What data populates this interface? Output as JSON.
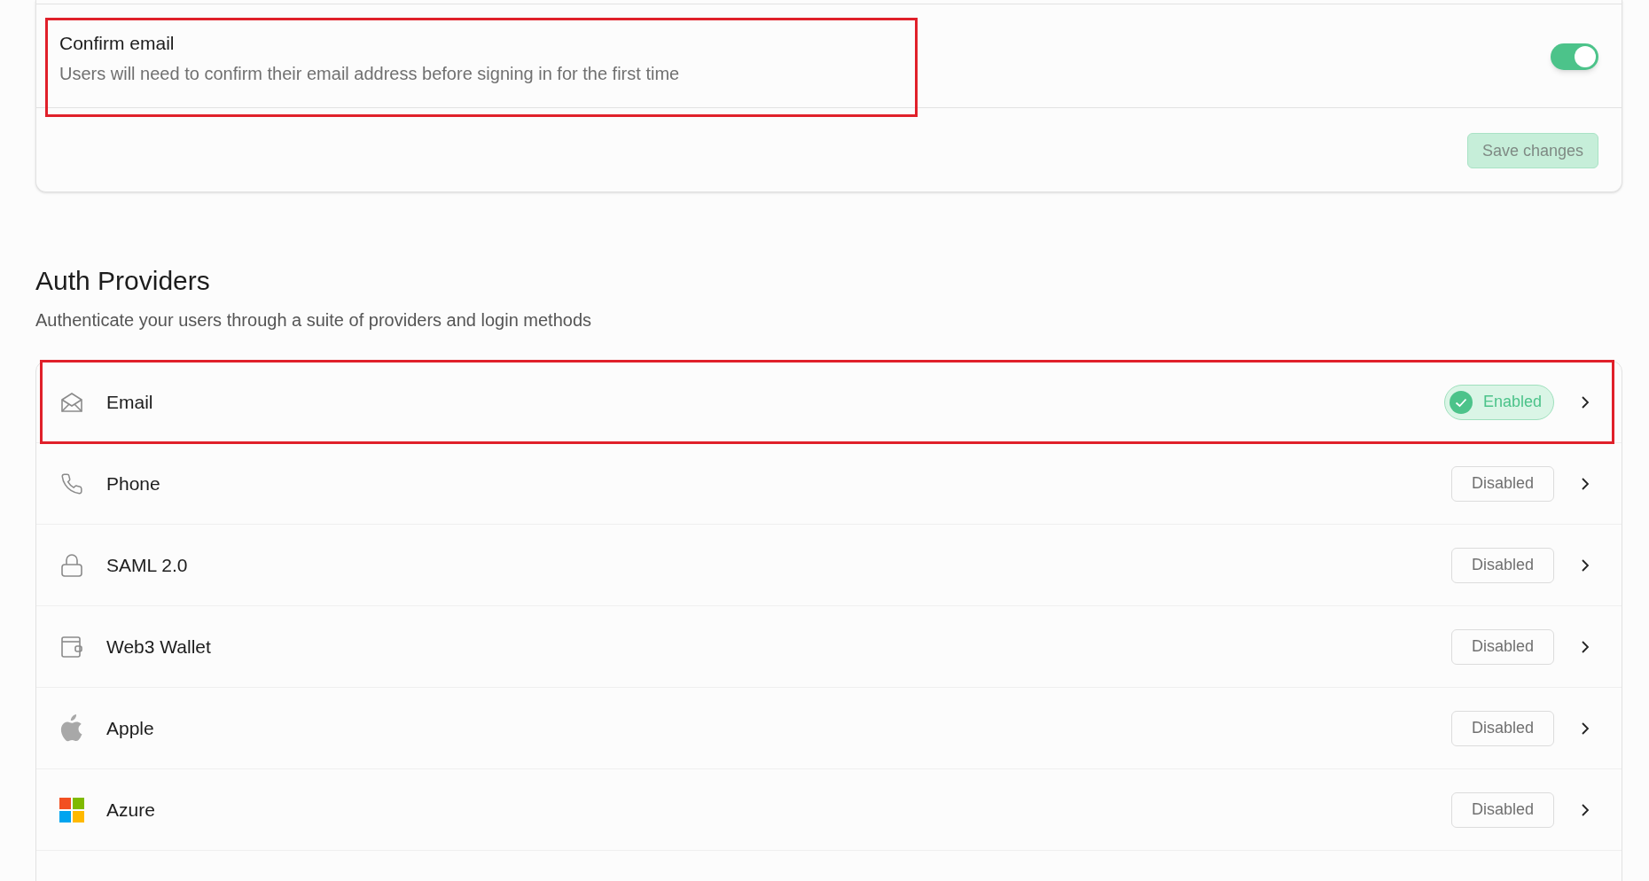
{
  "confirm_email": {
    "title": "Confirm email",
    "description": "Users will need to confirm their email address before signing in for the first time",
    "on": true,
    "highlighted": true
  },
  "save_button": {
    "label": "Save changes",
    "disabled": true
  },
  "auth_providers": {
    "title": "Auth Providers",
    "subtitle": "Authenticate your users through a suite of providers and login methods",
    "providers": [
      {
        "name": "Email",
        "enabled": true,
        "status": "Enabled",
        "highlighted": true
      },
      {
        "name": "Phone",
        "enabled": false,
        "status": "Disabled",
        "highlighted": false
      },
      {
        "name": "SAML 2.0",
        "enabled": false,
        "status": "Disabled",
        "highlighted": false
      },
      {
        "name": "Web3 Wallet",
        "enabled": false,
        "status": "Disabled",
        "highlighted": false
      },
      {
        "name": "Apple",
        "enabled": false,
        "status": "Disabled",
        "highlighted": false
      },
      {
        "name": "Azure",
        "enabled": false,
        "status": "Disabled",
        "highlighted": false
      }
    ]
  }
}
